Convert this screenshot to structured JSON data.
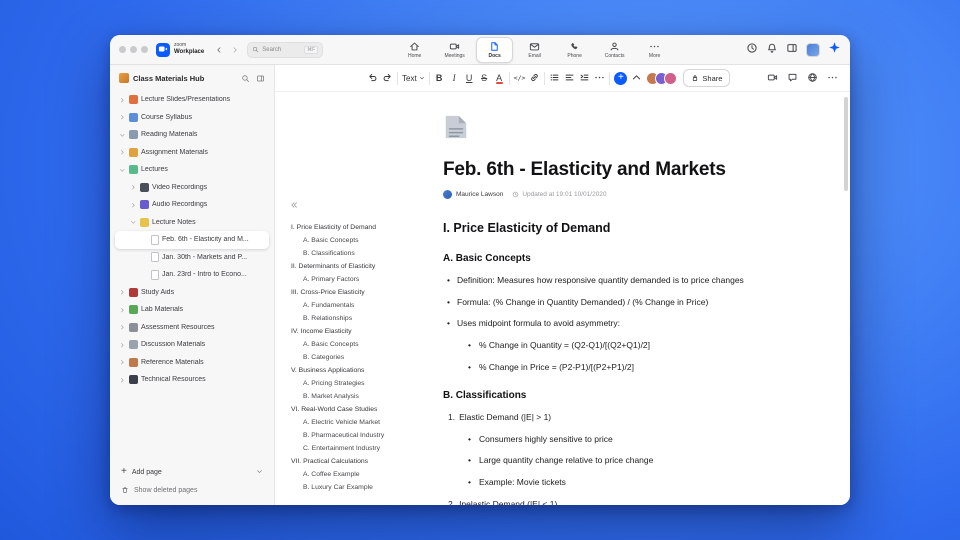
{
  "titlebar": {
    "brand_line1": "zoom",
    "brand_line2": "Workplace",
    "search_placeholder": "Search",
    "search_shortcut": "⌘F",
    "tabs": [
      {
        "label": "Home",
        "icon": "home",
        "active": false
      },
      {
        "label": "Meetings",
        "icon": "meetings",
        "active": false
      },
      {
        "label": "Docs",
        "icon": "docs",
        "active": true
      },
      {
        "label": "Email",
        "icon": "email",
        "active": false
      },
      {
        "label": "Phone",
        "icon": "phone",
        "active": false
      },
      {
        "label": "Contacts",
        "icon": "contacts",
        "active": false
      },
      {
        "label": "More",
        "icon": "more",
        "active": false
      }
    ]
  },
  "sidebar": {
    "title": "Class Materials Hub",
    "tree": [
      {
        "label": "Lecture Slides/Presentations",
        "level": 0,
        "chevron": "collapsed",
        "icon_color": "#e0713f"
      },
      {
        "label": "Course Syllabus",
        "level": 0,
        "chevron": "collapsed",
        "icon_color": "#5b8dd9"
      },
      {
        "label": "Reading Materials",
        "level": 0,
        "chevron": "expanded",
        "icon_color": "#8a9bb0"
      },
      {
        "label": "Assignment Materials",
        "level": 0,
        "chevron": "collapsed",
        "icon_color": "#e0a23f"
      },
      {
        "label": "Lectures",
        "level": 0,
        "chevron": "expanded",
        "icon_color": "#58b98a"
      },
      {
        "label": "Video Recordings",
        "level": 1,
        "chevron": "collapsed",
        "icon_color": "#4a4f5a"
      },
      {
        "label": "Audio Recordings",
        "level": 1,
        "chevron": "collapsed",
        "icon_color": "#6a5acd"
      },
      {
        "label": "Lecture Notes",
        "level": 1,
        "chevron": "expanded",
        "icon_color": "#e8c34a"
      },
      {
        "label": "Feb. 6th - Elasticity and M...",
        "level": 2,
        "page": true,
        "selected": true
      },
      {
        "label": "Jan. 30th - Markets and P...",
        "level": 2,
        "page": true
      },
      {
        "label": "Jan. 23rd - Intro to Econo...",
        "level": 2,
        "page": true
      },
      {
        "label": "Study Aids",
        "level": 0,
        "chevron": "collapsed",
        "icon_color": "#b03a3a"
      },
      {
        "label": "Lab Materials",
        "level": 0,
        "chevron": "collapsed",
        "icon_color": "#58a858"
      },
      {
        "label": "Assessment Resources",
        "level": 0,
        "chevron": "collapsed",
        "icon_color": "#8a8f98"
      },
      {
        "label": "Discussion Materials",
        "level": 0,
        "chevron": "collapsed",
        "icon_color": "#9aa3ad"
      },
      {
        "label": "Reference Materials",
        "level": 0,
        "chevron": "collapsed",
        "icon_color": "#c07a4a"
      },
      {
        "label": "Technical Resources",
        "level": 0,
        "chevron": "collapsed",
        "icon_color": "#3a3f4a"
      }
    ],
    "add_page_label": "Add page",
    "show_deleted_label": "Show deleted pages"
  },
  "toolbar": {
    "text_style_label": "Text",
    "share_label": "Share",
    "avatars": [
      "#c9784e",
      "#7a5fd0",
      "#d05f8a"
    ]
  },
  "document": {
    "title": "Feb. 6th - Elasticity and Markets",
    "author": "Maurice Lawson",
    "updated": "Updated at 19:01 10/01/2020",
    "toc": [
      {
        "label": "I. Price Elasticity of Demand",
        "level": 0
      },
      {
        "label": "A. Basic Concepts",
        "level": 1
      },
      {
        "label": "B. Classifications",
        "level": 1
      },
      {
        "label": "II. Determinants of Elasticity",
        "level": 0
      },
      {
        "label": "A. Primary Factors",
        "level": 1
      },
      {
        "label": "III. Cross-Price Elasticity",
        "level": 0
      },
      {
        "label": "A. Fundamentals",
        "level": 1
      },
      {
        "label": "B. Relationships",
        "level": 1
      },
      {
        "label": "IV. Income Elasticity",
        "level": 0
      },
      {
        "label": "A. Basic Concepts",
        "level": 1
      },
      {
        "label": "B. Categories",
        "level": 1
      },
      {
        "label": "V. Business Applications",
        "level": 0
      },
      {
        "label": "A. Pricing Strategies",
        "level": 1
      },
      {
        "label": "B. Market Analysis",
        "level": 1
      },
      {
        "label": "VI. Real-World Case Studies",
        "level": 0
      },
      {
        "label": "A. Electric Vehicle Market",
        "level": 1
      },
      {
        "label": "B. Pharmaceutical Industry",
        "level": 1
      },
      {
        "label": "C. Entertainment Industry",
        "level": 1
      },
      {
        "label": "VII. Practical Calculations",
        "level": 0
      },
      {
        "label": "A. Coffee Example",
        "level": 1
      },
      {
        "label": "B. Luxury Car Example",
        "level": 1
      }
    ],
    "body": [
      {
        "type": "h2",
        "text": "I. Price Elasticity of Demand"
      },
      {
        "type": "h3",
        "text": "A. Basic Concepts"
      },
      {
        "type": "bullet",
        "text": "Definition: Measures how responsive quantity demanded is to price changes"
      },
      {
        "type": "bullet",
        "text": "Formula: (% Change in Quantity Demanded) / (% Change in Price)"
      },
      {
        "type": "bullet",
        "text": "Uses midpoint formula to avoid asymmetry:"
      },
      {
        "type": "sub-bullet",
        "text": "% Change in Quantity = (Q2-Q1)/[(Q2+Q1)/2]"
      },
      {
        "type": "sub-bullet",
        "text": "% Change in Price = (P2-P1)/[(P2+P1)/2]"
      },
      {
        "type": "h3",
        "text": "B. Classifications"
      },
      {
        "type": "numbered",
        "number": "1.",
        "text": "Elastic Demand (|E| > 1)"
      },
      {
        "type": "sub-bullet",
        "text": "Consumers highly sensitive to price"
      },
      {
        "type": "sub-bullet",
        "text": "Large quantity change relative to price change"
      },
      {
        "type": "sub-bullet",
        "text": "Example: Movie tickets"
      },
      {
        "type": "numbered",
        "number": "2.",
        "text": "Inelastic Demand (|E| < 1)"
      }
    ]
  }
}
